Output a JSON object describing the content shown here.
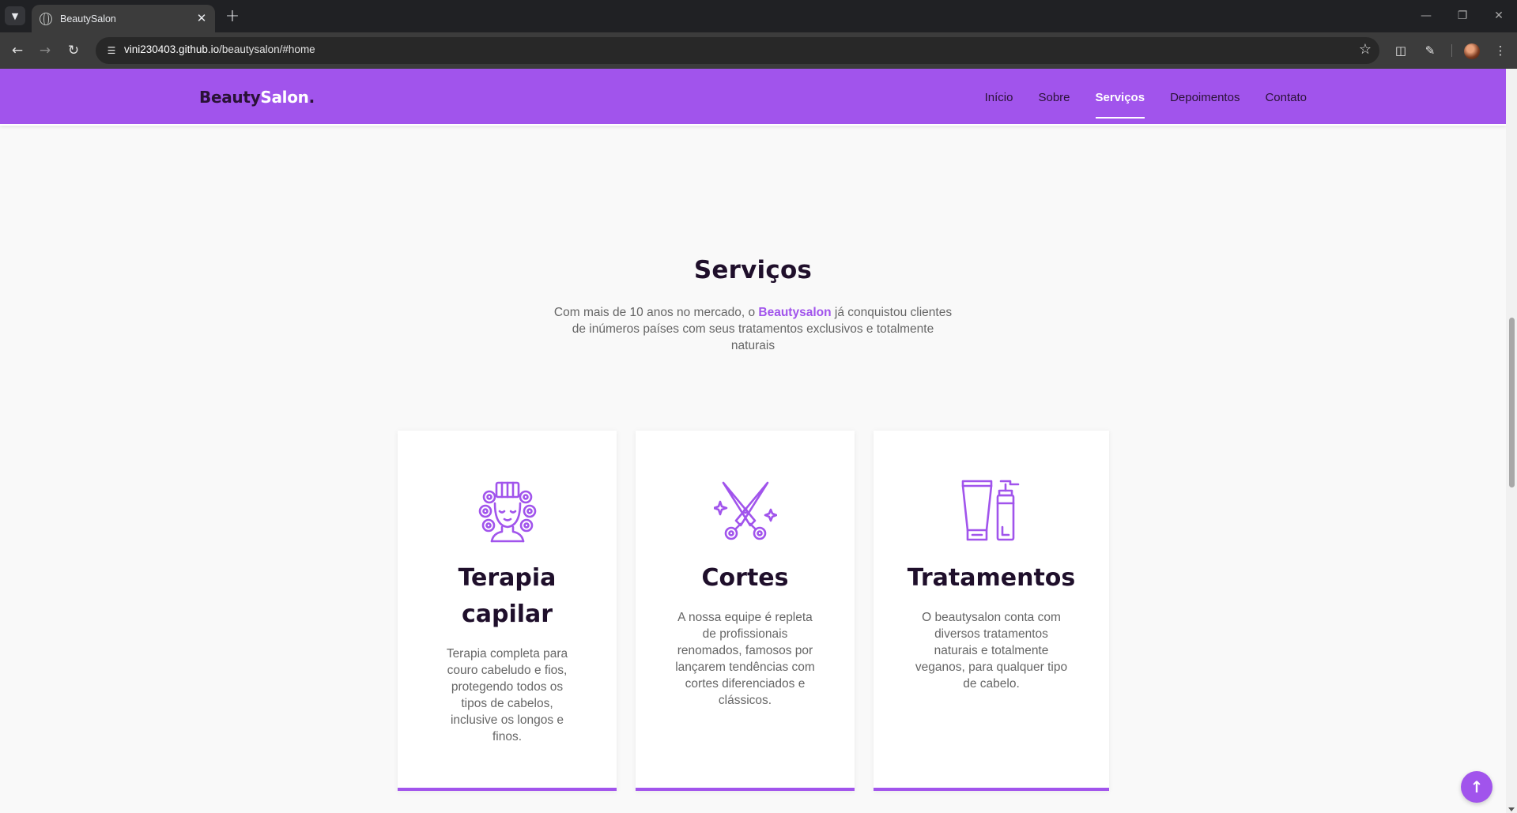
{
  "browser": {
    "tab_title": "BeautySalon",
    "url_host": "vini230403.github.io",
    "url_path": "/beautysalon/#home"
  },
  "header": {
    "logo_part1": "Beauty",
    "logo_part2": "Salon",
    "logo_dot": ".",
    "nav": [
      {
        "label": "Início",
        "active": false
      },
      {
        "label": "Sobre",
        "active": false
      },
      {
        "label": "Serviços",
        "active": true
      },
      {
        "label": "Depoimentos",
        "active": false
      },
      {
        "label": "Contato",
        "active": false
      }
    ]
  },
  "services": {
    "title": "Serviços",
    "desc_before": "Com mais de 10 anos no mercado, o ",
    "desc_brand": "Beautysalon",
    "desc_after": " já conquistou clientes de inúmeros países com seus tratamentos exclusivos e totalmente naturais",
    "cards": [
      {
        "icon": "hair-curlers-icon",
        "title": "Terapia capilar",
        "text": "Terapia completa para couro cabeludo e fios, protegendo todos os tipos de cabelos, inclusive os longos e finos."
      },
      {
        "icon": "scissors-icon",
        "title": "Cortes",
        "text": "A nossa equipe é repleta de profissionais renomados, famosos por lançarem tendências com cortes diferenciados e clássicos."
      },
      {
        "icon": "cosmetic-bottles-icon",
        "title": "Tratamentos",
        "text": "O beautysalon conta com diversos tratamentos naturais e totalmente veganos, para qualquer tipo de cabelo."
      }
    ]
  },
  "colors": {
    "accent": "#a154ec",
    "dark": "#1f0f2b",
    "text": "#666666"
  }
}
